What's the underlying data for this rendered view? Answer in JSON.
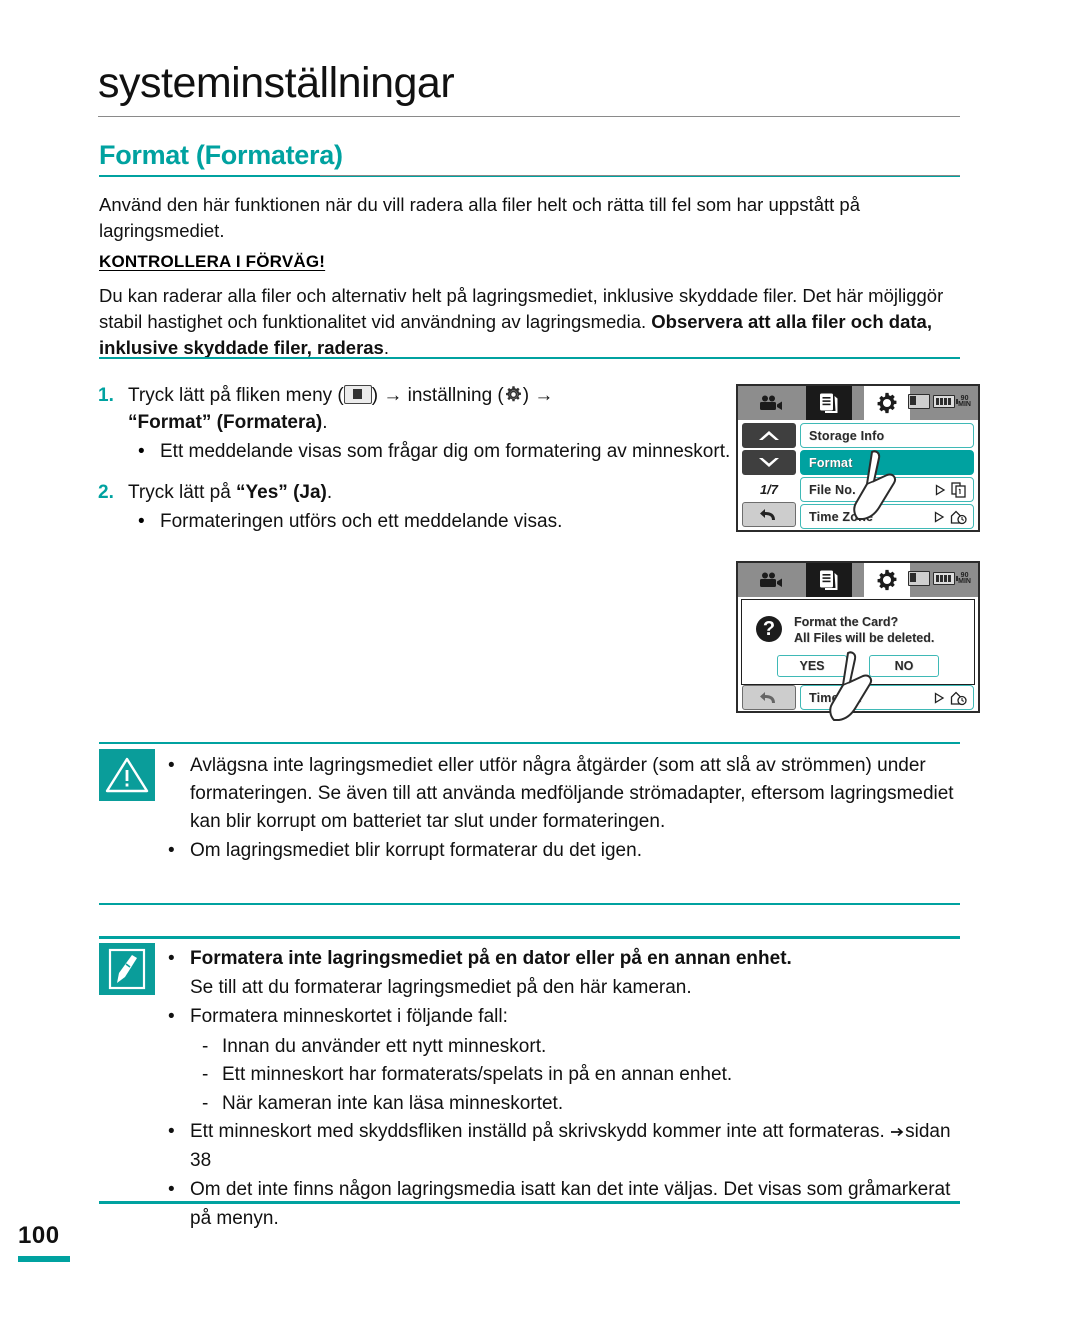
{
  "header": {
    "chapter_title": "systeminställningar",
    "section_title": "Format (Formatera)"
  },
  "intro": {
    "paragraph": "Använd den här funktionen när du vill radera alla filer helt och rätta till fel som har uppstått på lagringsmediet.",
    "precheck_heading": "KONTROLLERA I FÖRVÄG!",
    "precheck_body_normal": "Du kan raderar alla filer och alternativ helt på lagringsmediet, inklusive skyddade filer. Det här möjliggör stabil hastighet och funktionalitet vid användning av lagringsmedia. ",
    "precheck_body_bold": "Observera att alla filer och data, inklusive skyddade filer, raderas",
    "precheck_body_tail": "."
  },
  "steps": {
    "step1_num": "1.",
    "step1_a": "Tryck lätt på fliken meny (",
    "step1_b": ") → inställning (",
    "step1_c": ") →",
    "step1_bold": "“Format” (Formatera)",
    "step1_bold_tail": ".",
    "step1_bullet": "Ett meddelande visas som frågar dig om formatering av minneskort.",
    "step2_num": "2.",
    "step2_a": "Tryck lätt på ",
    "step2_bold": "“Yes” (Ja)",
    "step2_tail": ".",
    "step2_bullet": "Formateringen utförs och ett meddelande visas.",
    "bullet_glyph": "•"
  },
  "lcd1": {
    "battery_label": "90",
    "battery_unit": "MIN",
    "page_counter": "1/7",
    "rows": [
      {
        "label": "Storage Info",
        "selected": false,
        "has_arrow": false
      },
      {
        "label": "Format",
        "selected": true,
        "has_arrow": false
      },
      {
        "label": "File No.",
        "selected": false,
        "has_arrow": true
      },
      {
        "label": "Time Zone",
        "selected": false,
        "has_arrow": true
      }
    ]
  },
  "lcd2": {
    "battery_label": "90",
    "battery_unit": "MIN",
    "question_glyph": "?",
    "message_line1": "Format the Card?",
    "message_line2": "All Files will be deleted.",
    "yes_label": "YES",
    "no_label": "NO",
    "behind_row_label": "Time Zo."
  },
  "caution": {
    "bullet_glyph": "•",
    "items": [
      "Avlägsna inte lagringsmediet eller utför några åtgärder (som att slå av strömmen) under formateringen. Se även till att använda medföljande strömadapter, eftersom lagringsmediet kan blir korrupt om batteriet tar slut under formateringen.",
      "Om lagringsmediet blir korrupt formaterar du det igen."
    ]
  },
  "note": {
    "bullet_glyph": "•",
    "dash_glyph": "-",
    "item1_bold": "Formatera inte lagringsmediet på en dator eller på en annan enhet.",
    "item1_normal": "Se till att du formaterar lagringsmediet på den här kameran.",
    "item2": "Formatera minneskortet i följande fall:",
    "subitems": [
      "Innan du använder ett nytt minneskort.",
      "Ett minneskort har formaterats/spelats in på en annan enhet.",
      "När kameran inte kan läsa minneskortet."
    ],
    "item3_a": "Ett minneskort med skyddsfliken inställd på skrivskydd kommer inte att formateras. ",
    "item3_ref": "sidan 38",
    "item4": "Om det inte finns någon lagringsmedia isatt kan det inte väljas. Det visas som gråmarkerat på menyn."
  },
  "footer": {
    "page_number": "100"
  },
  "colors": {
    "teal": "#00a2a0",
    "teal_dark": "#0a9d9a",
    "text": "#111111",
    "lcd_topbar": "#8d8d8d"
  }
}
